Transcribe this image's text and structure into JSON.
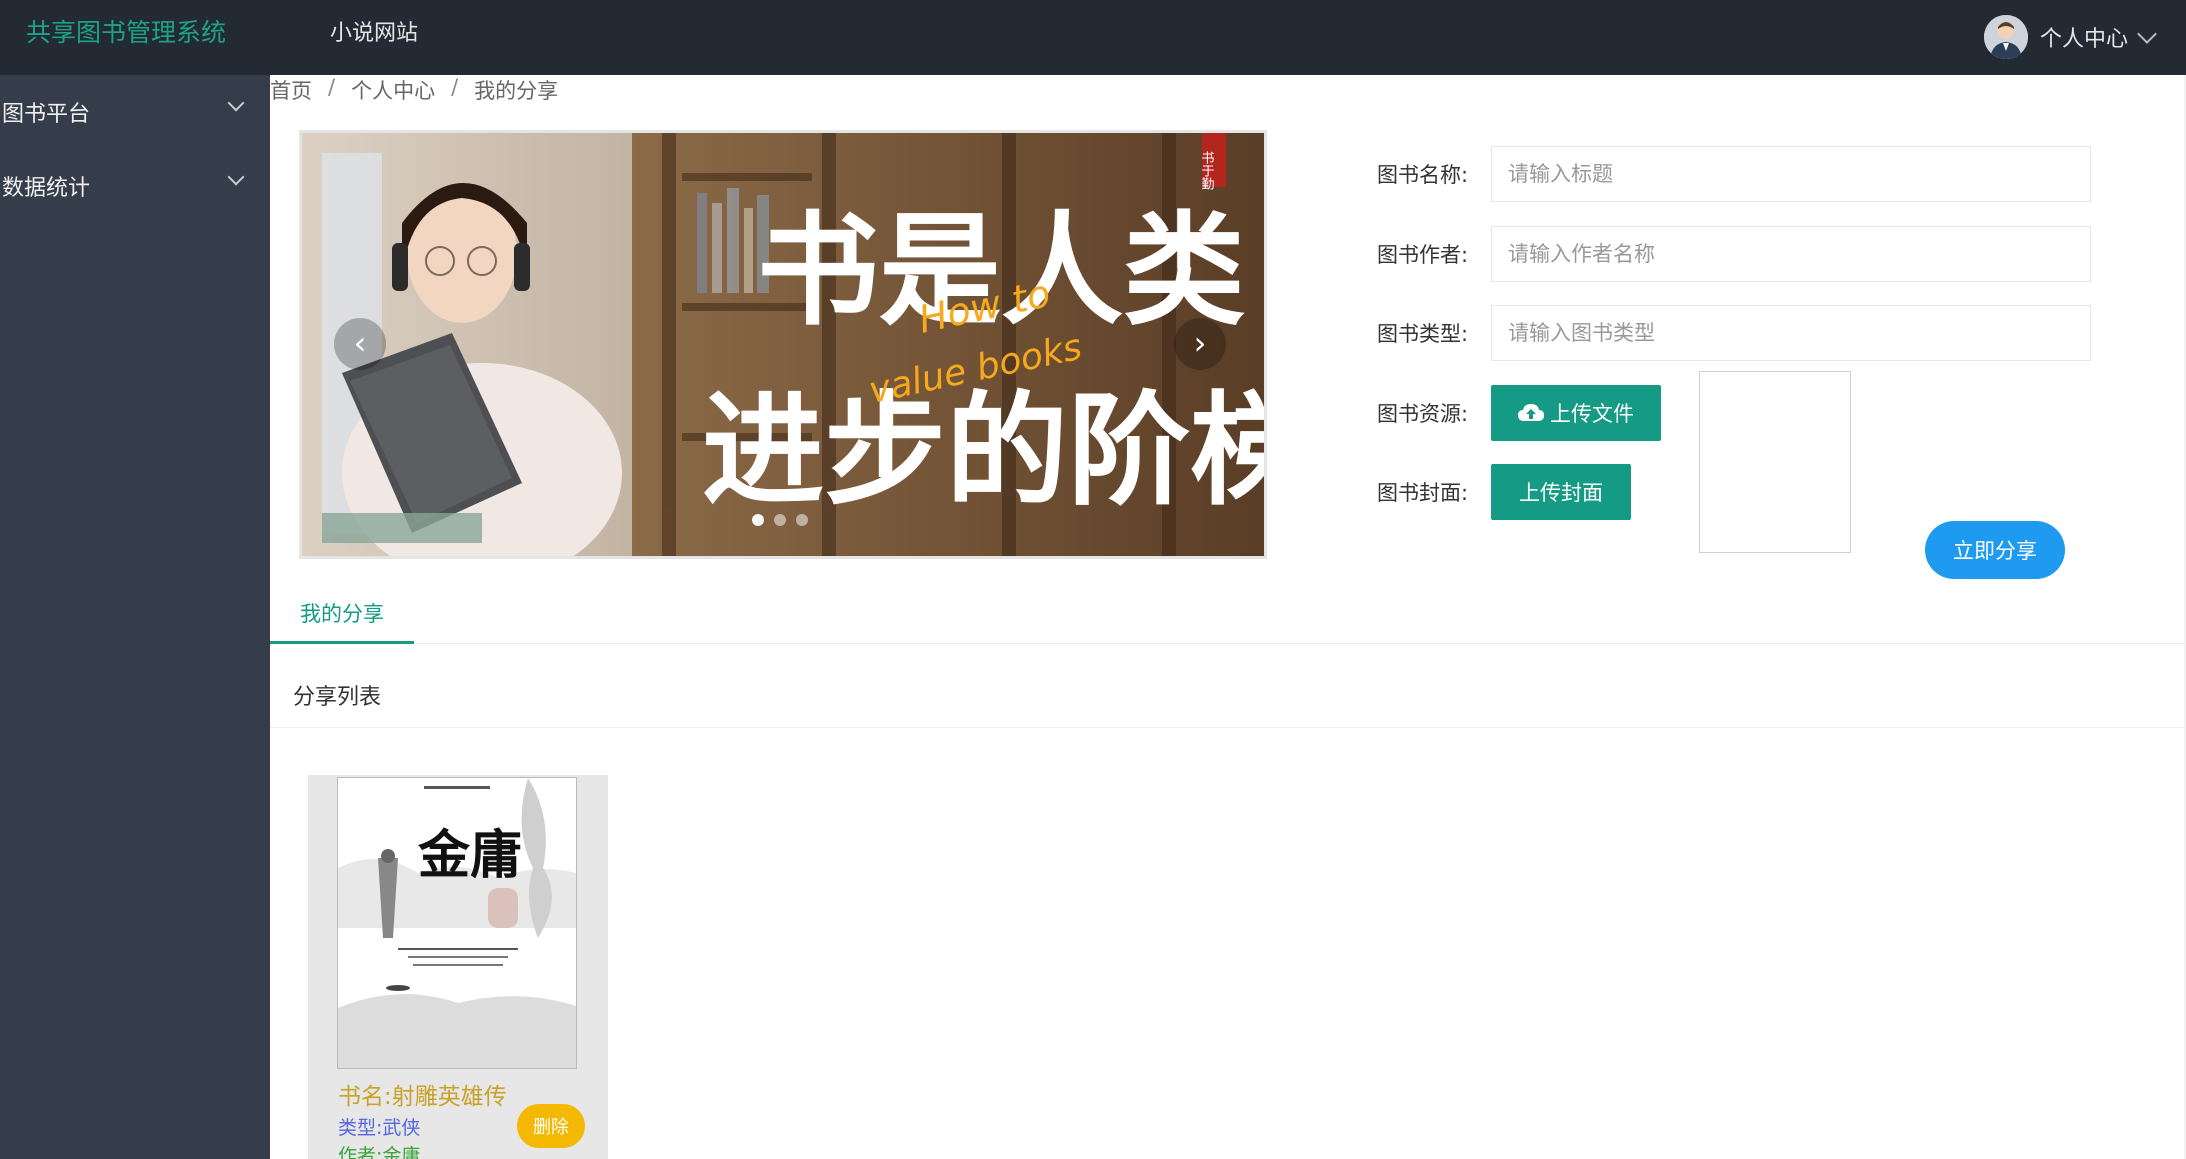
{
  "header": {
    "brand": "共享图书管理系统",
    "nav_link": "小说网站",
    "user_menu_label": "个人中心"
  },
  "sidebar": {
    "items": [
      {
        "label": "图书平台"
      },
      {
        "label": "数据统计"
      }
    ]
  },
  "breadcrumb": [
    "首页",
    "个人中心",
    "我的分享"
  ],
  "banner": {
    "text_line1": "书是人类",
    "text_line2": "进步的阶梯",
    "overlay_text_1": "How to",
    "overlay_text_2": "value books",
    "seal_text": "书于勤",
    "prev": "‹",
    "next": "›",
    "slide_count": 3,
    "active_slide": 1
  },
  "form": {
    "name_label": "图书名称:",
    "name_placeholder": "请输入标题",
    "author_label": "图书作者:",
    "author_placeholder": "请输入作者名称",
    "type_label": "图书类型:",
    "type_placeholder": "请输入图书类型",
    "resource_label": "图书资源:",
    "upload_file_label": "上传文件",
    "cover_label": "图书封面:",
    "upload_cover_label": "上传封面",
    "share_label": "立即分享"
  },
  "tabs": [
    {
      "label": "我的分享",
      "active": true
    }
  ],
  "list": {
    "title": "分享列表",
    "books": [
      {
        "name": "书名:射雕英雄传",
        "type": "类型:武侠",
        "author": "作者:金庸",
        "delete_label": "删除",
        "cover_title": "金庸"
      }
    ]
  },
  "colors": {
    "topbar": "#232a33",
    "sidebar": "#353d4b",
    "brand": "#1da18a",
    "teal_button": "#159a85",
    "share_button": "#1e9bf0",
    "delete_button": "#f5b800",
    "book_name": "#c9a227",
    "book_type": "#5566dd",
    "book_author": "#3aa33a"
  }
}
